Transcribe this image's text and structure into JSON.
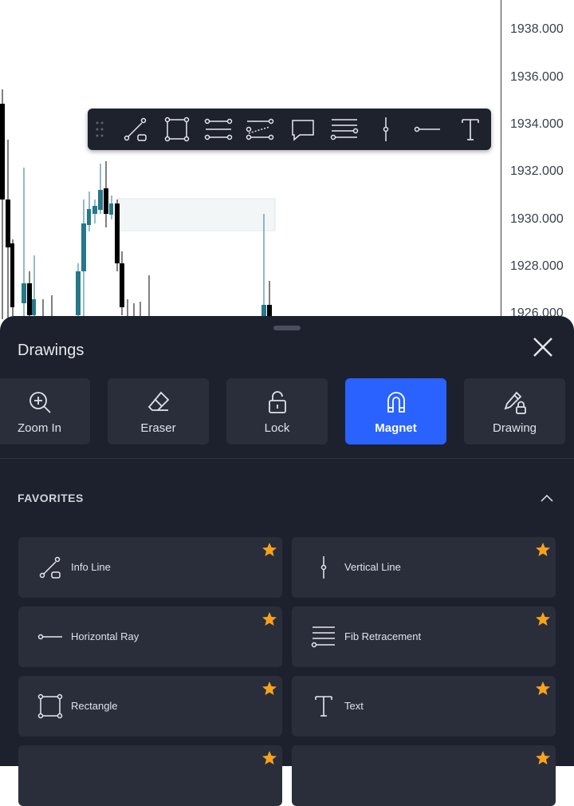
{
  "price_axis": {
    "labels": [
      "1938.000",
      "1936.000",
      "1934.000",
      "1932.000",
      "1930.000",
      "1928.000",
      "1926.000"
    ]
  },
  "floating_toolbar": {
    "tools": [
      "trend-line-icon",
      "rectangle-icon",
      "parallel-channel-icon",
      "regression-channel-icon",
      "callout-icon",
      "fib-retracement-icon",
      "vertical-line-icon",
      "horizontal-ray-icon",
      "text-icon"
    ]
  },
  "sheet": {
    "title": "Drawings",
    "modes": [
      {
        "label": "Zoom In",
        "icon": "zoom-in-icon",
        "active": false
      },
      {
        "label": "Eraser",
        "icon": "eraser-icon",
        "active": false
      },
      {
        "label": "Lock",
        "icon": "lock-icon",
        "active": false
      },
      {
        "label": "Magnet",
        "icon": "magnet-icon",
        "active": true
      },
      {
        "label": "Drawing",
        "icon": "lock-drawing-icon",
        "active": false
      }
    ],
    "favorites_title": "FAVORITES",
    "favorites": [
      {
        "label": "Info Line",
        "icon": "info-line-icon"
      },
      {
        "label": "Vertical Line",
        "icon": "vertical-line-icon"
      },
      {
        "label": "Horizontal Ray",
        "icon": "horizontal-ray-icon"
      },
      {
        "label": "Fib Retracement",
        "icon": "fib-retracement-icon"
      },
      {
        "label": "Rectangle",
        "icon": "rectangle-icon"
      },
      {
        "label": "Text",
        "icon": "text-icon"
      }
    ]
  },
  "colors": {
    "accent": "#2962ff",
    "star": "#f7a21b",
    "sheet_bg": "#1d212d",
    "card_bg": "#2a2e3b",
    "bull_candle": "#26788a",
    "bear_candle": "#000000"
  }
}
